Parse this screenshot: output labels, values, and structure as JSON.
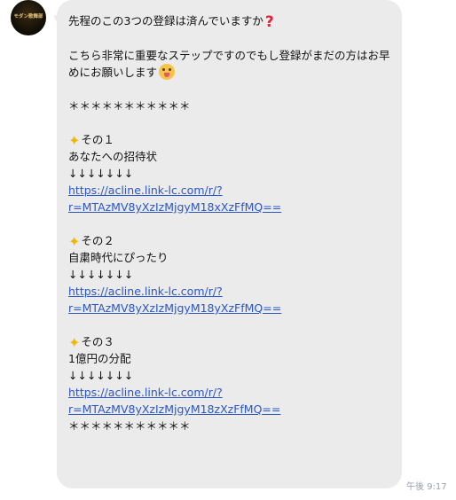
{
  "avatar": {
    "label": "モダン歌舞部"
  },
  "message": {
    "line1": "先程のこの3つの登録は済んでいますか",
    "line1_icon": "question-mark-icon",
    "line2": "こちら非常に重要なステップですのでもし登録がまだの方はお早めにお願いします",
    "line2_icon": "surprised-face-icon",
    "separator_top": "＊＊＊＊＊＊＊＊＊＊＊",
    "sections": [
      {
        "icon": "sparkle-icon",
        "heading": "その１",
        "title": "あなたへの招待状",
        "arrows": "↓↓↓↓↓↓↓",
        "link_line1": "https://acline.link-lc.com/r/?",
        "link_line2": "r=MTAzMV8yXzIzMjgyM18xXzFfMQ=="
      },
      {
        "icon": "sparkle-icon",
        "heading": "その２",
        "title": "自粛時代にぴったり",
        "arrows": "↓↓↓↓↓↓↓",
        "link_line1": "https://acline.link-lc.com/r/?",
        "link_line2": "r=MTAzMV8yXzIzMjgyM18yXzFfMQ=="
      },
      {
        "icon": "sparkle-icon",
        "heading": "その３",
        "title": "1億円の分配",
        "arrows": "↓↓↓↓↓↓↓",
        "link_line1": "https://acline.link-lc.com/r/?",
        "link_line2": "r=MTAzMV8yXzIzMjgyM18zXzFfMQ=="
      }
    ],
    "separator_bottom": "＊＊＊＊＊＊＊＊＊＊＊"
  },
  "timestamp": "午後 9:17",
  "colors": {
    "bubble": "#ebebeb",
    "link": "#2a56c6",
    "timestamp": "#9aa0a6"
  }
}
